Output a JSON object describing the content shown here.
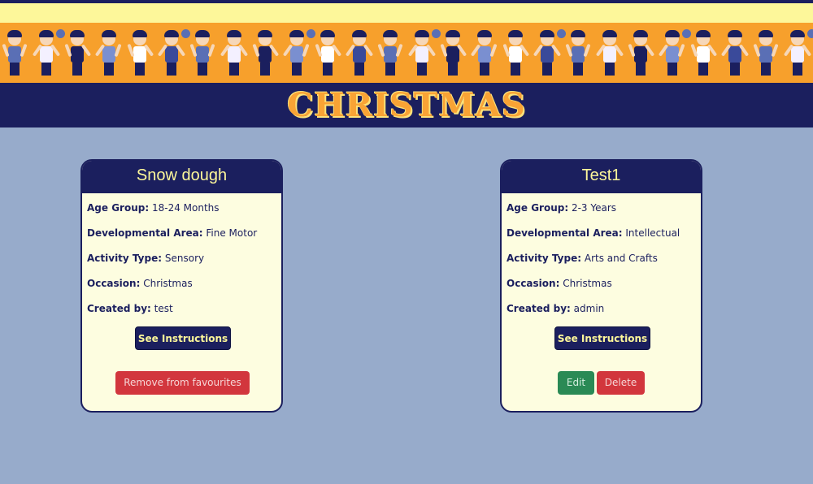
{
  "banner": {
    "title": "CHRISTMAS"
  },
  "cards": [
    {
      "title": "Snow dough",
      "fields": [
        {
          "label": "Age Group:",
          "value": "18-24 Months"
        },
        {
          "label": "Developmental Area:",
          "value": "Fine Motor"
        },
        {
          "label": "Activity Type:",
          "value": "Sensory"
        },
        {
          "label": "Occasion:",
          "value": "Christmas"
        },
        {
          "label": "Created by:",
          "value": "test"
        }
      ],
      "instructions_label": "See Instructions",
      "remove_label": "Remove from favourites"
    },
    {
      "title": "Test1",
      "fields": [
        {
          "label": "Age Group:",
          "value": "2-3 Years"
        },
        {
          "label": "Developmental Area:",
          "value": "Intellectual"
        },
        {
          "label": "Activity Type:",
          "value": "Arts and Crafts"
        },
        {
          "label": "Occasion:",
          "value": "Christmas"
        },
        {
          "label": "Created by:",
          "value": "admin"
        }
      ],
      "instructions_label": "See Instructions",
      "edit_label": "Edit",
      "delete_label": "Delete"
    }
  ],
  "colors": {
    "page_bg": "#97abcb",
    "navy": "#1b1f5e",
    "orange": "#f7a02c",
    "yellow": "#fdf79a",
    "card_bg": "#fdfde0",
    "danger": "#d2363d",
    "success": "#2a8a55"
  }
}
